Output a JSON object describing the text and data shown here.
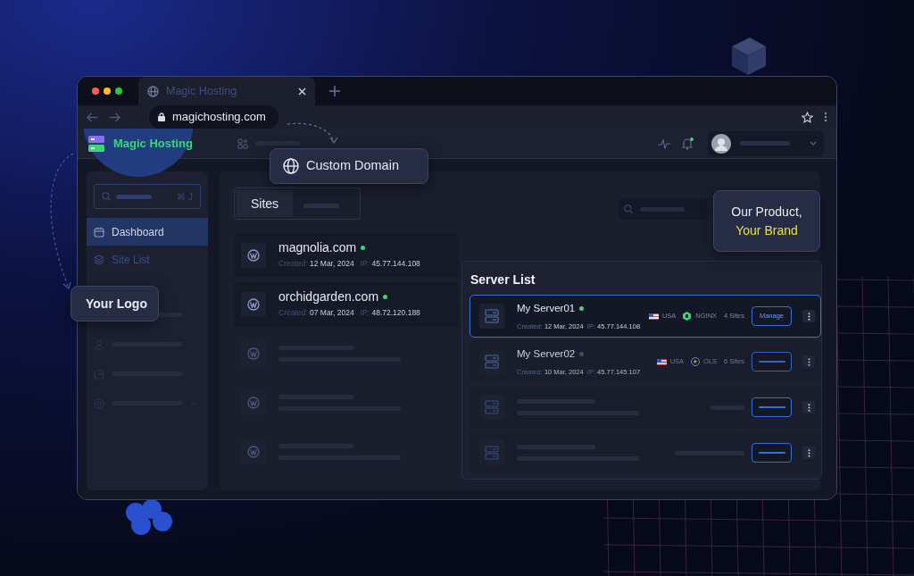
{
  "browser": {
    "tab_title": "Magic Hosting",
    "address": "magichosting.com"
  },
  "app": {
    "brand": "Magic Hosting"
  },
  "sidebar": {
    "search_shortcut": "⌘ J",
    "items": [
      {
        "label": "Dashboard",
        "selected": true
      },
      {
        "label": "Site List",
        "selected": false
      }
    ]
  },
  "tabs": [
    {
      "label": "Sites",
      "selected": true
    }
  ],
  "sites": [
    {
      "domain": "magnolia.com",
      "online": true,
      "created_label": "Created:",
      "created": "12 Mar, 2024",
      "ip_label": "IP:",
      "ip": "45.77.144.108"
    },
    {
      "domain": "orchidgarden.com",
      "online": true,
      "created_label": "Created:",
      "created": "07 Mar, 2024",
      "ip_label": "IP:",
      "ip": "48.72.120.188"
    }
  ],
  "server_list": {
    "title": "Server List",
    "servers": [
      {
        "name": "My Server01",
        "online": true,
        "selected": true,
        "created_label": "Created:",
        "created": "12 Mar, 2024",
        "ip_label": "IP:",
        "ip": "45.77.144.108",
        "country": "USA",
        "stack": "NGINX",
        "kind": "nginx",
        "sites": "4 Sites",
        "action": "Manage"
      },
      {
        "name": "My Server02",
        "online": false,
        "selected": false,
        "created_label": "Created:",
        "created": "10 Mar, 2024",
        "ip_label": "IP:",
        "ip": "45.77.145.107",
        "country": "USA",
        "stack": "OLS",
        "kind": "ols",
        "sites": "6 Sites"
      }
    ]
  },
  "callouts": {
    "custom_domain": "Custom Domain",
    "logo": "Your Logo",
    "product": "Our Product,",
    "brand": "Your Brand"
  }
}
